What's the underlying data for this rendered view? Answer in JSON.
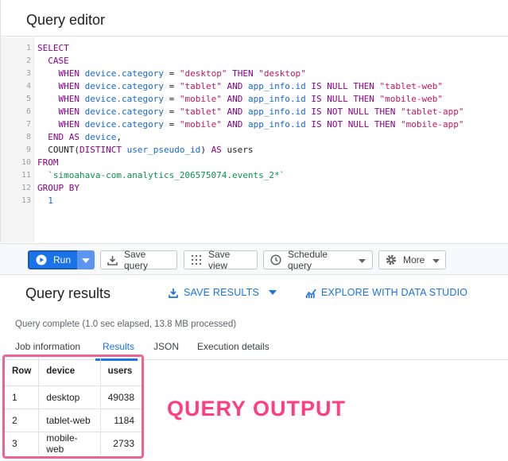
{
  "editor": {
    "title": "Query editor",
    "lines": [
      {
        "n": "1",
        "segs": [
          [
            "kw",
            "SELECT"
          ]
        ]
      },
      {
        "n": "2",
        "segs": [
          [
            "",
            "  "
          ],
          [
            "kw",
            "CASE"
          ]
        ]
      },
      {
        "n": "3",
        "segs": [
          [
            "",
            "    "
          ],
          [
            "kw",
            "WHEN "
          ],
          [
            "fld",
            "device.category"
          ],
          [
            "",
            " = "
          ],
          [
            "str",
            "\"desktop\""
          ],
          [
            "kw",
            " THEN "
          ],
          [
            "str",
            "\"desktop\""
          ]
        ]
      },
      {
        "n": "4",
        "segs": [
          [
            "",
            "    "
          ],
          [
            "kw",
            "WHEN "
          ],
          [
            "fld",
            "device.category"
          ],
          [
            "",
            " = "
          ],
          [
            "str",
            "\"tablet\""
          ],
          [
            "kw",
            " AND "
          ],
          [
            "fld",
            "app_info.id"
          ],
          [
            "kw",
            " IS NULL THEN "
          ],
          [
            "str",
            "\"tablet-web\""
          ]
        ]
      },
      {
        "n": "5",
        "segs": [
          [
            "",
            "    "
          ],
          [
            "kw",
            "WHEN "
          ],
          [
            "fld",
            "device.category"
          ],
          [
            "",
            " = "
          ],
          [
            "str",
            "\"mobile\""
          ],
          [
            "kw",
            " AND "
          ],
          [
            "fld",
            "app_info.id"
          ],
          [
            "kw",
            " IS NULL THEN "
          ],
          [
            "str",
            "\"mobile-web\""
          ]
        ]
      },
      {
        "n": "6",
        "segs": [
          [
            "",
            "    "
          ],
          [
            "kw",
            "WHEN "
          ],
          [
            "fld",
            "device.category"
          ],
          [
            "",
            " = "
          ],
          [
            "str",
            "\"tablet\""
          ],
          [
            "kw",
            " AND "
          ],
          [
            "fld",
            "app_info.id"
          ],
          [
            "kw",
            " IS NOT NULL THEN "
          ],
          [
            "str",
            "\"tablet-app\""
          ]
        ]
      },
      {
        "n": "7",
        "segs": [
          [
            "",
            "    "
          ],
          [
            "kw",
            "WHEN "
          ],
          [
            "fld",
            "device.category"
          ],
          [
            "",
            " = "
          ],
          [
            "str",
            "\"mobile\""
          ],
          [
            "kw",
            " AND "
          ],
          [
            "fld",
            "app_info.id"
          ],
          [
            "kw",
            " IS NOT NULL THEN "
          ],
          [
            "str",
            "\"mobile-app\""
          ]
        ]
      },
      {
        "n": "8",
        "segs": [
          [
            "",
            "  "
          ],
          [
            "kw",
            "END AS "
          ],
          [
            "fld",
            "device"
          ],
          [
            "",
            ","
          ]
        ]
      },
      {
        "n": "9",
        "segs": [
          [
            "",
            "  COUNT("
          ],
          [
            "kw",
            "DISTINCT "
          ],
          [
            "fld",
            "user_pseudo_id"
          ],
          [
            "",
            ") "
          ],
          [
            "kw",
            "AS "
          ],
          [
            "",
            "users"
          ]
        ]
      },
      {
        "n": "10",
        "segs": [
          [
            "kw",
            "FROM"
          ]
        ]
      },
      {
        "n": "11",
        "segs": [
          [
            "",
            "  "
          ],
          [
            "tbl",
            "`simoahava-com.analytics_206575074.events_2*`"
          ]
        ]
      },
      {
        "n": "12",
        "segs": [
          [
            "kw",
            "GROUP BY"
          ]
        ]
      },
      {
        "n": "13",
        "segs": [
          [
            "",
            "  "
          ],
          [
            "num",
            "1"
          ]
        ]
      }
    ]
  },
  "toolbar": {
    "run_label": "Run",
    "save_query_label": "Save query",
    "save_view_label": "Save view",
    "schedule_query_label": "Schedule query",
    "more_label": "More"
  },
  "results": {
    "title": "Query results",
    "save_results_label": "SAVE RESULTS",
    "explore_label": "EXPLORE WITH DATA STUDIO",
    "status": "Query complete (1.0 sec elapsed, 13.8 MB processed)",
    "tabs": [
      "Job information",
      "Results",
      "JSON",
      "Execution details"
    ],
    "active_tab": "Results",
    "columns": [
      "Row",
      "device",
      "users"
    ],
    "rows": [
      [
        "1",
        "desktop",
        "49038"
      ],
      [
        "2",
        "tablet-web",
        "1184"
      ],
      [
        "3",
        "mobile-web",
        "2733"
      ]
    ]
  },
  "annotation": "QUERY OUTPUT",
  "colors": {
    "accent": "#1a73e8",
    "annotation": "#ff3d7f",
    "highlight_border": "#f06292"
  }
}
